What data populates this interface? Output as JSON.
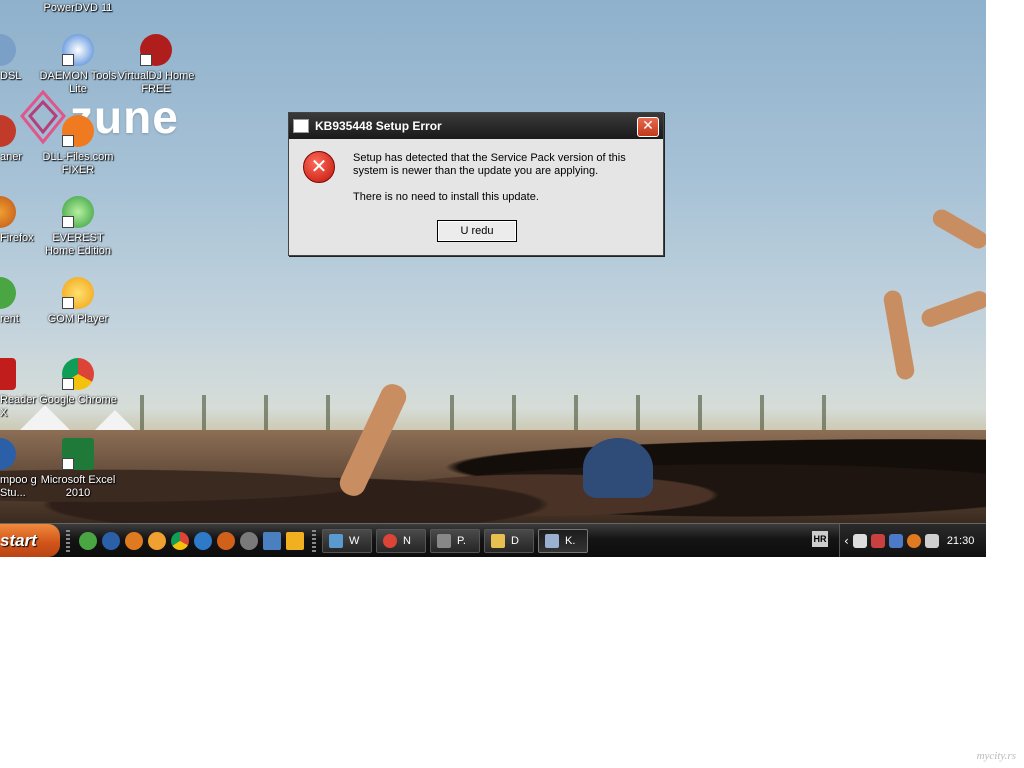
{
  "desktop": {
    "icons": [
      {
        "label": "PowerDVD 11"
      },
      {
        "label": "DSL"
      },
      {
        "label": "DAEMON Tools Lite"
      },
      {
        "label": "VirtualDJ Home FREE"
      },
      {
        "label": "aner"
      },
      {
        "label": "DLL-Files.com FIXER"
      },
      {
        "label": "Firefox"
      },
      {
        "label": "EVEREST Home Edition"
      },
      {
        "label": "rent"
      },
      {
        "label": "GOM Player"
      },
      {
        "label": "Reader X"
      },
      {
        "label": "Google Chrome"
      },
      {
        "label": "mpoo g Stu..."
      },
      {
        "label": "Microsoft Excel 2010"
      }
    ],
    "logo_text": "zune"
  },
  "dialog": {
    "title": "KB935448 Setup Error",
    "close_symbol": "✕",
    "error_symbol": "✕",
    "message_line1": "Setup has detected that the Service Pack version of this system is newer than the update you are applying.",
    "message_line2": "There is no need to install this update.",
    "button_label": "U redu"
  },
  "taskbar": {
    "start_label": "start",
    "tasks": [
      {
        "label": "W"
      },
      {
        "label": "N"
      },
      {
        "label": "P."
      },
      {
        "label": "D"
      },
      {
        "label": "K.",
        "active": true
      }
    ],
    "language": "HR",
    "clock": "21:30"
  },
  "watermark": "mycity.rs",
  "colors": {
    "taskbar": "#141414",
    "start": "#d2561b",
    "dialog_bg": "#e5e5e5",
    "error_red": "#c0140a"
  }
}
